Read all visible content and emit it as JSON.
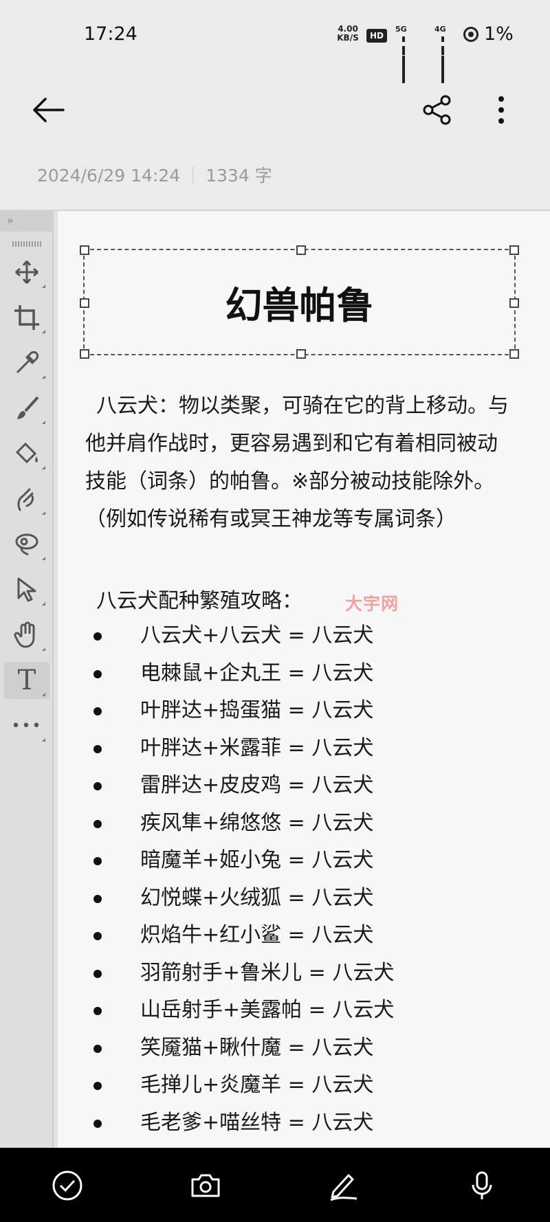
{
  "status_bar": {
    "time": "17:24",
    "net_speed": "4.00",
    "net_speed_unit": "KB/S",
    "hd_badge": "HD",
    "sim1_tag": "5G",
    "sim2_tag": "4G",
    "battery": "1%"
  },
  "header": {
    "back_icon": "arrow-left-icon",
    "share_icon": "share-icon",
    "more_icon": "more-vertical-icon"
  },
  "meta": {
    "datetime": "2024/6/29 14:24",
    "word_count": "1334 字"
  },
  "palette": {
    "collapse_label": "»",
    "tools": [
      "move-icon",
      "crop-icon",
      "eyedropper-icon",
      "brush-icon",
      "fill-bucket-icon",
      "smudge-icon",
      "lasso-icon",
      "select-arrow-icon",
      "hand-icon",
      "text-tool-icon",
      "more-horizontal-icon"
    ],
    "text_tool_label": "T",
    "more_label": "•••"
  },
  "document": {
    "title": "幻兽帕鲁",
    "intro": "八云犬：物以类聚，可骑在它的背上移动。与他并肩作战时，更容易遇到和它有着相同被动技能（词条）的帕鲁。※部分被动技能除外。 （例如传说稀有或冥王神龙等专属词条）",
    "subheading": "八云犬配种繁殖攻略：",
    "watermark": "大宇网",
    "recipes": [
      "八云犬+八云犬 = 八云犬",
      "电棘鼠+企丸王 = 八云犬",
      "叶胖达+捣蛋猫 = 八云犬",
      "叶胖达+米露菲 = 八云犬",
      "雷胖达+皮皮鸡 = 八云犬",
      "疾风隼+绵悠悠 = 八云犬",
      "暗魔羊+姬小兔 = 八云犬",
      "幻悦蝶+火绒狐 = 八云犬",
      "炽焰牛+红小鲨 = 八云犬",
      "羽箭射手+鲁米儿 = 八云犬",
      "山岳射手+美露帕 = 八云犬",
      "笑魇猫+瞅什魔 = 八云犬",
      "毛掸儿+炎魔羊 = 八云犬",
      "毛老爹+喵丝特 = 八云犬"
    ]
  },
  "bottom_bar": {
    "items": [
      "check-circle-icon",
      "camera-icon",
      "pen-icon",
      "microphone-icon"
    ]
  }
}
